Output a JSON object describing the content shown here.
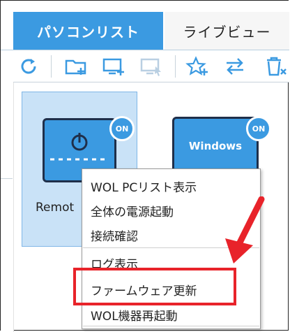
{
  "tabs": {
    "active_label": "パソコンリスト",
    "inactive_label": "ライブビュー"
  },
  "toolbar": {
    "icons": [
      "refresh-icon",
      "add-folder-icon",
      "add-pc-icon",
      "remote-pc-icon",
      "favorite-add-icon",
      "swap-icon",
      "delete-pc-icon"
    ]
  },
  "devices": [
    {
      "label": "Remot",
      "status": "ON",
      "selected": true
    },
    {
      "label": "Windows",
      "status": "ON",
      "selected": false
    }
  ],
  "context_menu": {
    "items": [
      "WOL PCリスト表示",
      "全体の電源起動",
      "接続確認",
      "ログ表示",
      "ファームウェア更新",
      "WOL機器再起動"
    ]
  },
  "colors": {
    "accent": "#3b9ae1",
    "highlight": "#e8232a",
    "selected_bg": "#c9e2f7"
  }
}
